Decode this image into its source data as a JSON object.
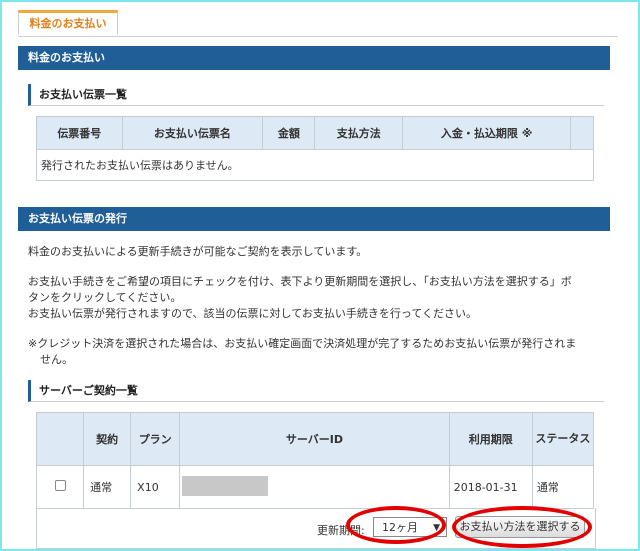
{
  "tab": {
    "label": "料金のお支払い"
  },
  "section_payment": {
    "title": "料金のお支払い"
  },
  "slip_list": {
    "title": "お支払い伝票一覧",
    "columns": [
      "伝票番号",
      "お支払い伝票名",
      "金額",
      "支払方法",
      "入金・払込期限 ※"
    ],
    "empty_message": "発行されたお支払い伝票はありません。"
  },
  "section_issue": {
    "title": "お支払い伝票の発行"
  },
  "instructions": {
    "line1": "料金のお支払いによる更新手続きが可能なご契約を表示しています。",
    "line2": "お支払い手続きをご希望の項目にチェックを付け、表下より更新期間を選択し、「お支払い方法を選択する」ボ",
    "line3": "タンをクリックしてください。",
    "line4": "お支払い伝票が発行されますので、該当の伝票に対してお支払い手続きを行ってください。",
    "note1": "※クレジット決済を選択された場合は、お支払い確定画面で決済処理が完了するためお支払い伝票が発行されま",
    "note2": "せん。"
  },
  "server_list": {
    "title": "サーバーご契約一覧",
    "columns": [
      "",
      "契約",
      "プラン",
      "サーバーID",
      "利用期限",
      "ステータス"
    ],
    "rows": [
      {
        "contract": "通常",
        "plan": "X10",
        "server_id": "",
        "expiry": "2018-01-31",
        "status": "通常"
      }
    ]
  },
  "renewal": {
    "period_label": "更新期間:",
    "period_value": "12ヶ月",
    "submit_label": "お支払い方法を選択する"
  },
  "colors": {
    "header_blue": "#1f5e96",
    "table_header": "#dde9f5",
    "tab_accent": "#f2a83a",
    "highlight": "#e30000"
  }
}
